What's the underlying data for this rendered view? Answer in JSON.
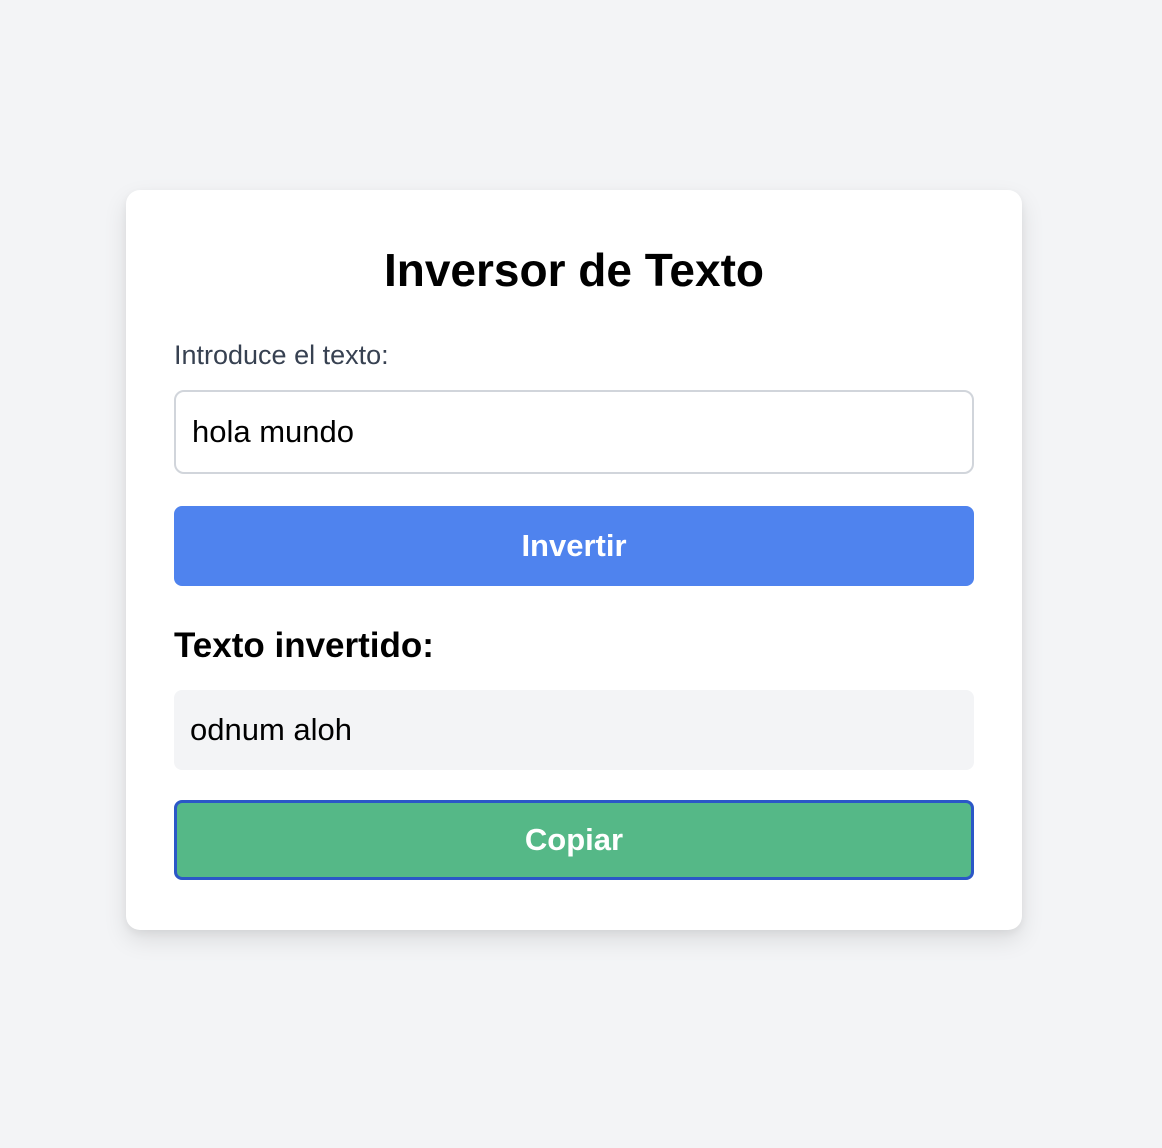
{
  "app": {
    "title": "Inversor de Texto"
  },
  "form": {
    "input_label": "Introduce el texto:",
    "input_value": "hola mundo",
    "invert_button_label": "Invertir"
  },
  "result": {
    "heading": "Texto invertido:",
    "value": "odnum aloh",
    "copy_button_label": "Copiar"
  },
  "colors": {
    "background": "#f3f4f6",
    "card": "#ffffff",
    "invert_button": "#4f83ee",
    "copy_button": "#55b887",
    "focus_ring": "#2b57c7",
    "result_box": "#f3f4f6"
  }
}
